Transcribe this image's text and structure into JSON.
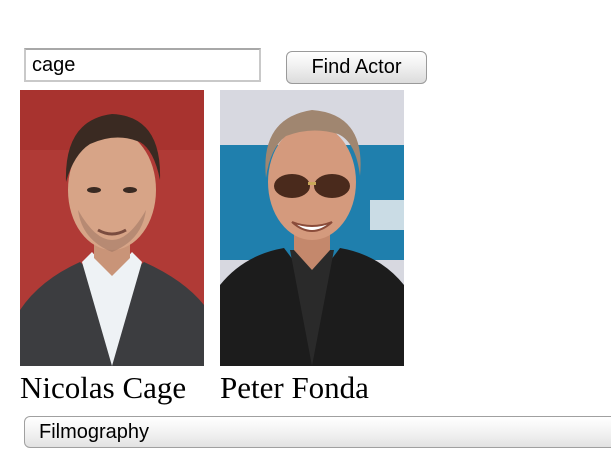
{
  "search": {
    "value": "cage"
  },
  "find_button": {
    "label": "Find Actor"
  },
  "results": [
    {
      "name": "Nicolas Cage"
    },
    {
      "name": "Peter Fonda"
    }
  ],
  "filmography_select": {
    "selected": "Filmography"
  },
  "colors": {
    "photo_1_background": "#b03a36",
    "photo_2_background": "#d7d8e0",
    "photo_2_banner": "#1a6e9a"
  }
}
